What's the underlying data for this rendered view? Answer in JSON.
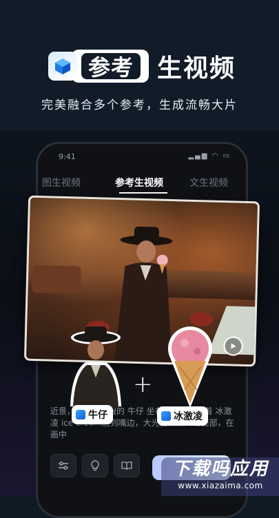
{
  "header": {
    "title_highlight": "参考",
    "title_rest": "生视频",
    "subtitle": "完美融合多个参考，生成流畅大片"
  },
  "phone": {
    "status_time": "9:41",
    "tabs": [
      {
        "label": "图生视频"
      },
      {
        "label": "参考生视频",
        "active": true
      },
      {
        "label": "文生视频"
      }
    ],
    "prompt_text": "近景，穿着牛仔服的 牛仔 坐在吧台前，拿着 冰激凌 ice cream送到嘴边，大光圈聚焦人物面部，在画中"
  },
  "stickers": {
    "cowboy_label": "牛仔",
    "icecream_label": "冰激凌"
  },
  "watermark": {
    "main": "下载吗应用",
    "url": "www.xiazaima.com"
  },
  "colors": {
    "background": "#0b0f16",
    "accent_blue": "#1062d6"
  }
}
